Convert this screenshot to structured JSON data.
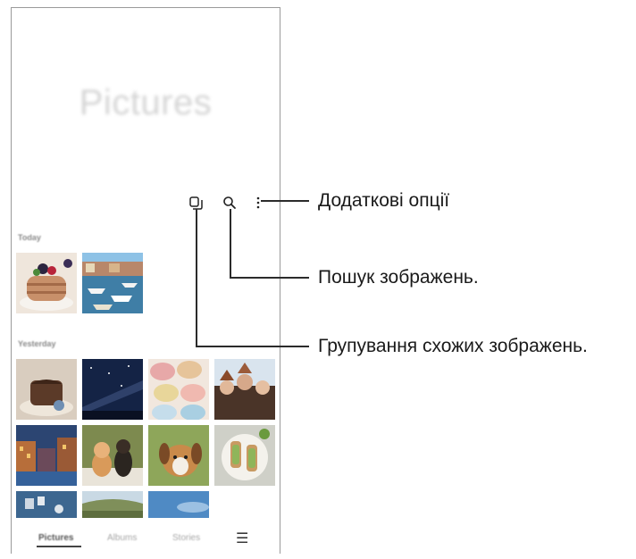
{
  "app": {
    "title": "Pictures",
    "sections": [
      {
        "label": "Today"
      },
      {
        "label": "Yesterday"
      }
    ],
    "toolbar_icons": [
      "group-similar-icon",
      "search-icon",
      "more-options-icon"
    ],
    "thumbnails": [
      {
        "subject": "pancakes",
        "color": "#c8906a"
      },
      {
        "subject": "harbor boats",
        "color": "#5f8bb0"
      },
      {
        "subject": "chocolate cake",
        "color": "#8a6a52"
      },
      {
        "subject": "night sky",
        "color": "#1b2a4a"
      },
      {
        "subject": "macarons",
        "color": "#e3b9a6"
      },
      {
        "subject": "party people",
        "color": "#6a4a3a"
      },
      {
        "subject": "venice canal",
        "color": "#35507a"
      },
      {
        "subject": "cat and dog",
        "color": "#6e7a4a"
      },
      {
        "subject": "dog",
        "color": "#8a9a52"
      },
      {
        "subject": "avocado toast",
        "color": "#d6d6cf"
      },
      {
        "subject": "wall",
        "color": "#3d6790"
      },
      {
        "subject": "landscape",
        "color": "#8a9a6a"
      },
      {
        "subject": "sky",
        "color": "#4f8ac4"
      }
    ],
    "bottom_nav": {
      "tabs": [
        "Pictures",
        "Albums",
        "Stories"
      ],
      "active": "Pictures",
      "menu_icon": "hamburger-menu-icon"
    }
  },
  "callouts": [
    {
      "text": "Додаткові опції"
    },
    {
      "text": "Пошук зображень."
    },
    {
      "text": "Групування схожих зображень."
    }
  ],
  "colors": {
    "leader_line": "#2b2b2b",
    "frame_border": "#9a9a9a"
  }
}
